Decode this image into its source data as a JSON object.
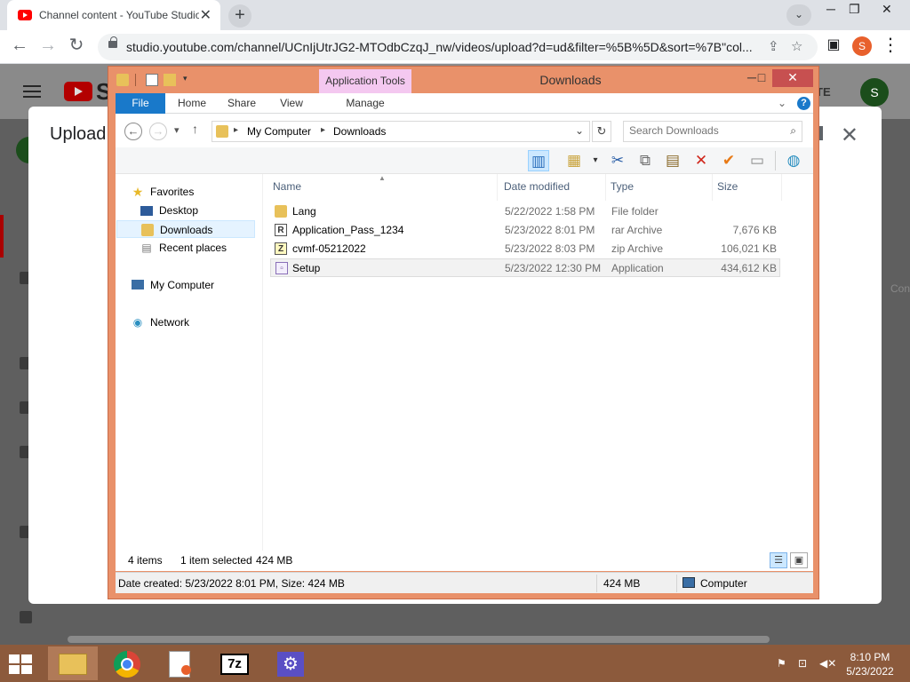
{
  "browser": {
    "tab_title": "Channel content - YouTube Studio",
    "tab_close": "✕",
    "new_tab": "+",
    "url": "studio.youtube.com/channel/UCnIjUtrJG2-MTOdbCzqJ_nw/videos/upload?d=ud&filter=%5B%5D&sort=%7B\"col...",
    "profile_initial": "S",
    "minimize": "─",
    "restore": "❐",
    "close": "✕"
  },
  "youtube": {
    "logo_fragment": "S",
    "create_fragment": "TE",
    "avatar_initial": "S",
    "side_fragment": "Con",
    "upload_title": "Upload",
    "upload_close": "✕"
  },
  "explorer": {
    "title": "Downloads",
    "app_tools": "Application Tools",
    "tabs": {
      "file": "File",
      "home": "Home",
      "share": "Share",
      "view": "View",
      "manage": "Manage"
    },
    "breadcrumb": [
      "My Computer",
      "Downloads"
    ],
    "search_placeholder": "Search Downloads",
    "nav": {
      "favorites": "Favorites",
      "desktop": "Desktop",
      "downloads": "Downloads",
      "recent": "Recent places",
      "my_computer": "My Computer",
      "network": "Network"
    },
    "columns": {
      "name": "Name",
      "date": "Date modified",
      "type": "Type",
      "size": "Size"
    },
    "files": [
      {
        "name": "Lang",
        "date": "5/22/2022 1:58 PM",
        "type": "File folder",
        "size": "",
        "icon": "folder-icon"
      },
      {
        "name": "Application_Pass_1234",
        "date": "5/23/2022 8:01 PM",
        "type": "rar Archive",
        "size": "7,676 KB",
        "icon": "rar-archive-icon"
      },
      {
        "name": "cvmf-05212022",
        "date": "5/23/2022 8:03 PM",
        "type": "zip Archive",
        "size": "106,021 KB",
        "icon": "zip-archive-icon"
      },
      {
        "name": "Setup",
        "date": "5/23/2022 12:30 PM",
        "type": "Application",
        "size": "434,612 KB",
        "icon": "application-icon"
      }
    ],
    "status": {
      "items": "4 items",
      "selected": "1 item selected",
      "selected_size": "424 MB"
    },
    "details": {
      "info": "Date created: 5/23/2022 8:01 PM, Size: 424 MB",
      "size": "424 MB",
      "location": "Computer"
    }
  },
  "taskbar": {
    "time": "8:10 PM",
    "date": "5/23/2022",
    "sevenzip": "7z"
  },
  "colors": {
    "explorer_frame": "#e9916a",
    "ribbon_file": "#1979ca",
    "app_tools": "#f4c8f0",
    "taskbar": "#8c5a3c",
    "close_red": "#c75050"
  }
}
